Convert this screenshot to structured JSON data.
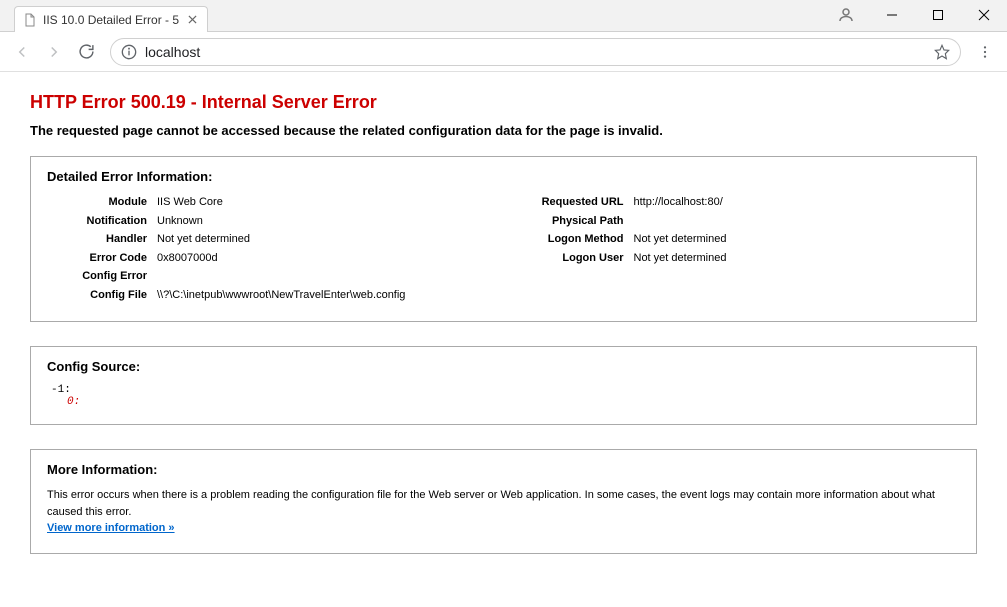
{
  "window": {
    "tab_title": "IIS 10.0 Detailed Error - 5"
  },
  "urlbar": {
    "url": "localhost"
  },
  "error": {
    "heading": "HTTP Error 500.19 - Internal Server Error",
    "subheading": "The requested page cannot be accessed because the related configuration data for the page is invalid."
  },
  "detail_section": {
    "title": "Detailed Error Information:",
    "left": {
      "module_label": "Module",
      "module_val": "IIS Web Core",
      "notification_label": "Notification",
      "notification_val": "Unknown",
      "handler_label": "Handler",
      "handler_val": "Not yet determined",
      "error_code_label": "Error Code",
      "error_code_val": "0x8007000d",
      "config_error_label": "Config Error",
      "config_error_val": "",
      "config_file_label": "Config File",
      "config_file_val": "\\\\?\\C:\\inetpub\\wwwroot\\NewTravelEnter\\web.config"
    },
    "right": {
      "requested_url_label": "Requested URL",
      "requested_url_val": "http://localhost:80/",
      "physical_path_label": "Physical Path",
      "physical_path_val": "",
      "logon_method_label": "Logon Method",
      "logon_method_val": "Not yet determined",
      "logon_user_label": "Logon User",
      "logon_user_val": "Not yet determined"
    }
  },
  "config_source": {
    "title": "Config Source:",
    "line1": "-1:",
    "line2": "0:"
  },
  "more_info": {
    "title": "More Information:",
    "body": "This error occurs when there is a problem reading the configuration file for the Web server or Web application. In some cases, the event logs may contain more information about what caused this error.",
    "link": "View more information »"
  }
}
